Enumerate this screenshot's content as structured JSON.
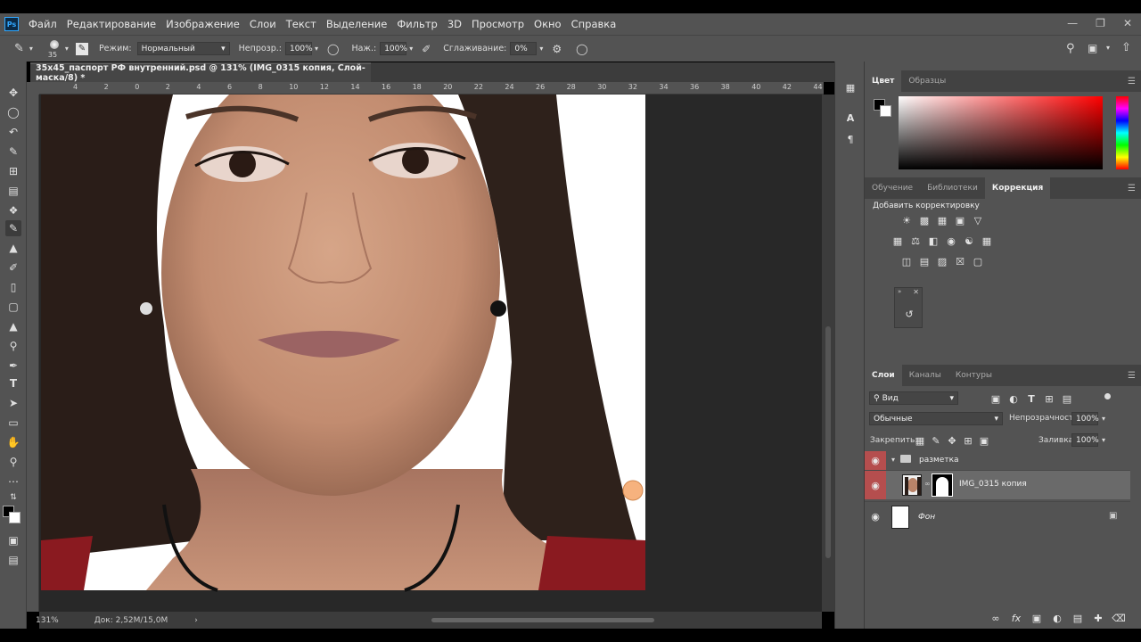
{
  "app": {
    "logo": "Ps"
  },
  "menu": [
    "Файл",
    "Редактирование",
    "Изображение",
    "Слои",
    "Текст",
    "Выделение",
    "Фильтр",
    "3D",
    "Просмотр",
    "Окно",
    "Справка"
  ],
  "options": {
    "brush_size": "35",
    "mode_label": "Режим:",
    "mode_value": "Нормальный",
    "opacity_label": "Непрозр.:",
    "opacity_value": "100%",
    "pressure_label": "Наж.:",
    "pressure_value": "100%",
    "smoothing_label": "Сглаживание:",
    "smoothing_value": "0%"
  },
  "document": {
    "tab_title": "35x45_паспорт РФ внутренний.psd @ 131% (IMG_0315 копия, Слой-маска/8) *",
    "zoom": "131%",
    "doc_info": "Док: 2,52M/15,0M",
    "ruler_top": [
      "4",
      "2",
      "0",
      "2",
      "4",
      "6",
      "8",
      "10",
      "12",
      "14",
      "16",
      "18",
      "20",
      "22",
      "24",
      "26",
      "28",
      "30",
      "32",
      "34",
      "36",
      "38",
      "40",
      "42",
      "44"
    ]
  },
  "color_panel": {
    "tabs": [
      "Цвет",
      "Образцы"
    ],
    "active": "Цвет",
    "fg_color": "#000000",
    "bg_color": "#ffffff",
    "hue_color": "#ff0000"
  },
  "adjustments_panel": {
    "tabs": [
      "Обучение",
      "Библиотеки",
      "Коррекция"
    ],
    "active": "Коррекция",
    "heading": "Добавить корректировку"
  },
  "layers_panel": {
    "tabs": [
      "Слои",
      "Каналы",
      "Контуры"
    ],
    "active": "Слои",
    "filter_value": "Вид",
    "blend_mode": "Обычные",
    "opacity_label": "Непрозрачность:",
    "opacity_value": "100%",
    "lock_label": "Закрепить:",
    "fill_label": "Заливка:",
    "fill_value": "100%",
    "layers": [
      {
        "name": "разметка",
        "type": "group"
      },
      {
        "name": "IMG_0315 копия",
        "type": "masked",
        "selected": true
      },
      {
        "name": "Фон",
        "type": "background",
        "locked": true
      }
    ]
  },
  "colors": {
    "ui_bg": "#535353",
    "eye_active": "#b54e4e",
    "brush_cursor": "#f6b27e",
    "shirt": "#8a1a20"
  }
}
